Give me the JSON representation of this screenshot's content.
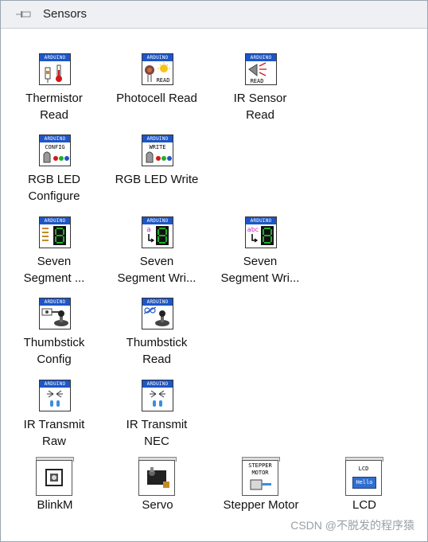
{
  "palette": {
    "title": "Sensors",
    "pin_icon": "pin-icon"
  },
  "items": [
    {
      "label": "Thermistor\nRead",
      "header": "ARDUINO",
      "icon": "thermistor-icon"
    },
    {
      "label": "Photocell Read",
      "header": "ARDUINO",
      "icon": "photocell-icon",
      "sub": "READ"
    },
    {
      "label": "IR Sensor\nRead",
      "header": "ARDUINO",
      "icon": "ir-sensor-icon",
      "sub": "READ"
    },
    {
      "label": "RGB LED\nConfigure",
      "header": "ARDUINO",
      "icon": "rgb-led-config-icon",
      "sub": "CONFIG"
    },
    {
      "label": "RGB LED Write",
      "header": "ARDUINO",
      "icon": "rgb-led-write-icon",
      "sub": "WRITE"
    },
    {
      "label": "Seven\nSegment ...",
      "header": "ARDUINO",
      "icon": "seven-segment-config-icon"
    },
    {
      "label": "Seven\nSegment Wri...",
      "header": "ARDUINO",
      "icon": "seven-segment-write-char-icon",
      "sub": "a"
    },
    {
      "label": "Seven\nSegment Wri...",
      "header": "ARDUINO",
      "icon": "seven-segment-write-string-icon",
      "sub": "abc"
    },
    {
      "label": "Thumbstick\nConfig",
      "header": "ARDUINO",
      "icon": "thumbstick-config-icon"
    },
    {
      "label": "Thumbstick\nRead",
      "header": "ARDUINO",
      "icon": "thumbstick-read-icon"
    },
    {
      "label": "IR Transmit\nRaw",
      "header": "ARDUINO",
      "icon": "ir-transmit-raw-icon"
    },
    {
      "label": "IR Transmit\nNEC",
      "header": "ARDUINO",
      "icon": "ir-transmit-nec-icon"
    }
  ],
  "devices": [
    {
      "label": "BlinkM",
      "icon": "blinkm-icon"
    },
    {
      "label": "Servo",
      "icon": "servo-icon"
    },
    {
      "label": "Stepper Motor",
      "icon": "stepper-motor-icon",
      "caption": "STEPPER\nMOTOR"
    },
    {
      "label": "LCD",
      "icon": "lcd-icon",
      "caption": "LCD",
      "screen_text": "Hello"
    }
  ],
  "colors": {
    "header_blue": "#1d56c6",
    "segment_green": "#1fb02a",
    "magenta": "#d020c8"
  },
  "watermark": "CSDN @不脱发的程序猿"
}
